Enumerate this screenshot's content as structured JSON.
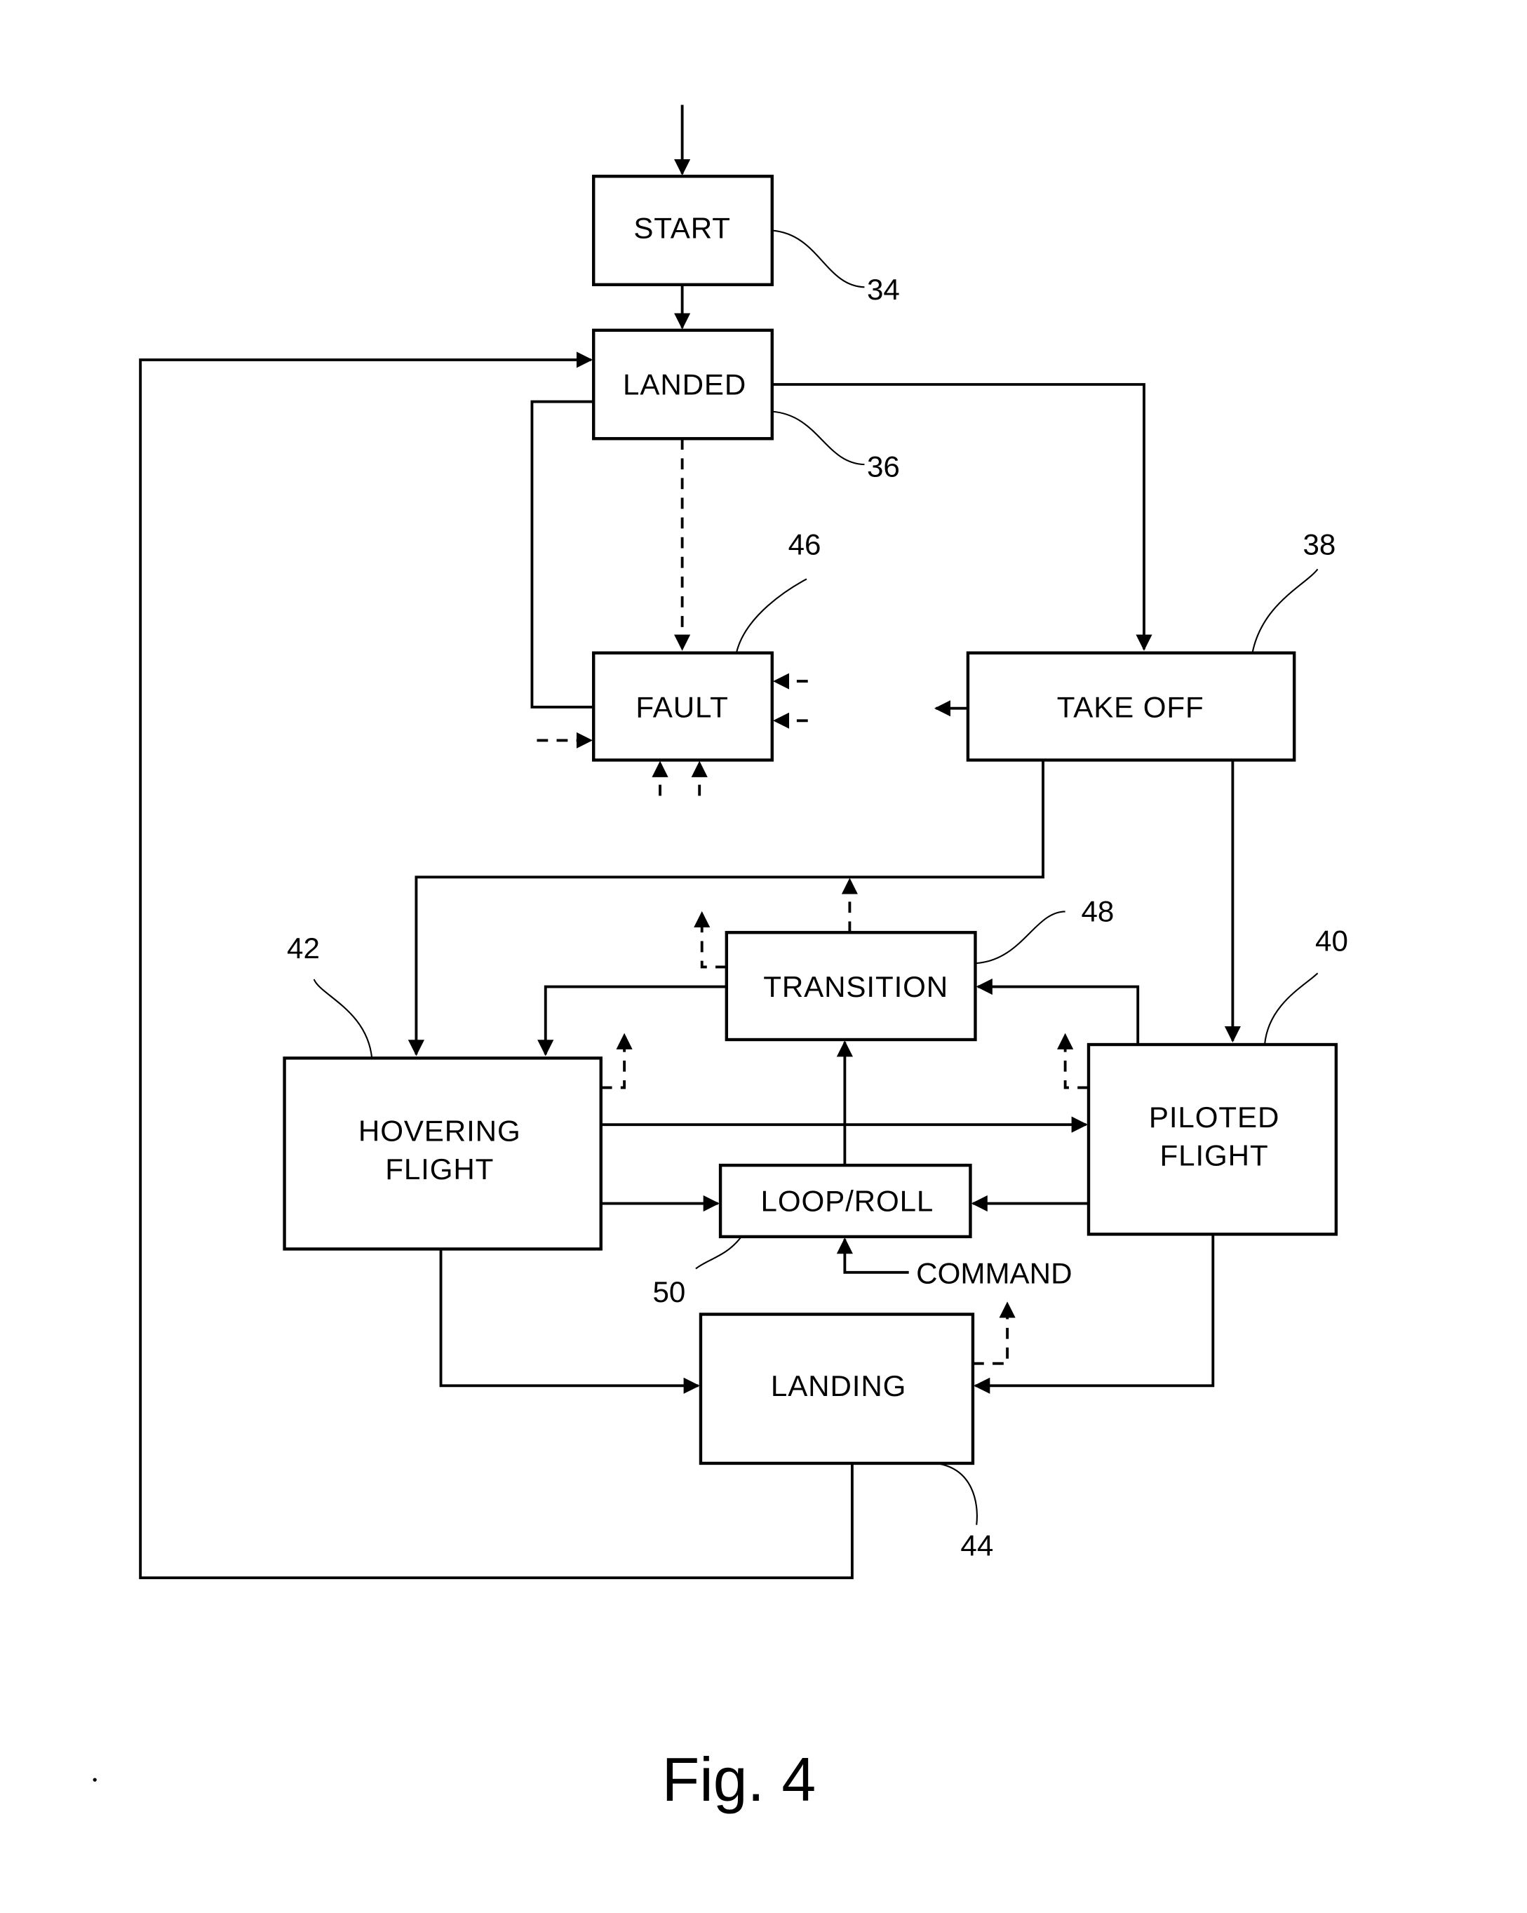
{
  "figure": {
    "caption": "Fig. 4",
    "nodes": {
      "start": {
        "label": "START",
        "ref": "34"
      },
      "landed": {
        "label": "LANDED",
        "ref": "36"
      },
      "fault": {
        "label": "FAULT",
        "ref": "46"
      },
      "take_off": {
        "label": "TAKE OFF",
        "ref": "38"
      },
      "transition": {
        "label": "TRANSITION",
        "ref": "48"
      },
      "hovering": {
        "label_line1": "HOVERING",
        "label_line2": "FLIGHT",
        "ref": "42"
      },
      "piloted": {
        "label_line1": "PILOTED",
        "label_line2": "FLIGHT",
        "ref": "40"
      },
      "loop_roll": {
        "label": "LOOP/ROLL",
        "ref": "50"
      },
      "landing": {
        "label": "LANDING",
        "ref": "44"
      }
    },
    "inputs": {
      "command": "COMMAND"
    },
    "edges": [
      {
        "from": "entry",
        "to": "start",
        "style": "solid"
      },
      {
        "from": "start",
        "to": "landed",
        "style": "solid"
      },
      {
        "from": "landed",
        "to": "take_off",
        "style": "solid"
      },
      {
        "from": "landed",
        "to": "fault",
        "style": "dashed"
      },
      {
        "from": "fault",
        "to": "landed",
        "style": "solid"
      },
      {
        "from": "take_off",
        "to": "hovering",
        "style": "solid"
      },
      {
        "from": "take_off",
        "to": "piloted",
        "style": "solid"
      },
      {
        "from": "transition",
        "to": "hovering",
        "style": "solid"
      },
      {
        "from": "piloted",
        "to": "transition",
        "style": "solid"
      },
      {
        "from": "loop_roll",
        "to": "transition",
        "style": "solid"
      },
      {
        "from": "hovering",
        "to": "piloted",
        "style": "solid"
      },
      {
        "from": "hovering",
        "to": "loop_roll",
        "style": "solid"
      },
      {
        "from": "piloted",
        "to": "loop_roll",
        "style": "solid"
      },
      {
        "from": "command",
        "to": "loop_roll",
        "style": "solid"
      },
      {
        "from": "hovering",
        "to": "landing",
        "style": "solid"
      },
      {
        "from": "piloted",
        "to": "landing",
        "style": "solid"
      },
      {
        "from": "landing",
        "to": "landed",
        "style": "solid"
      }
    ]
  }
}
